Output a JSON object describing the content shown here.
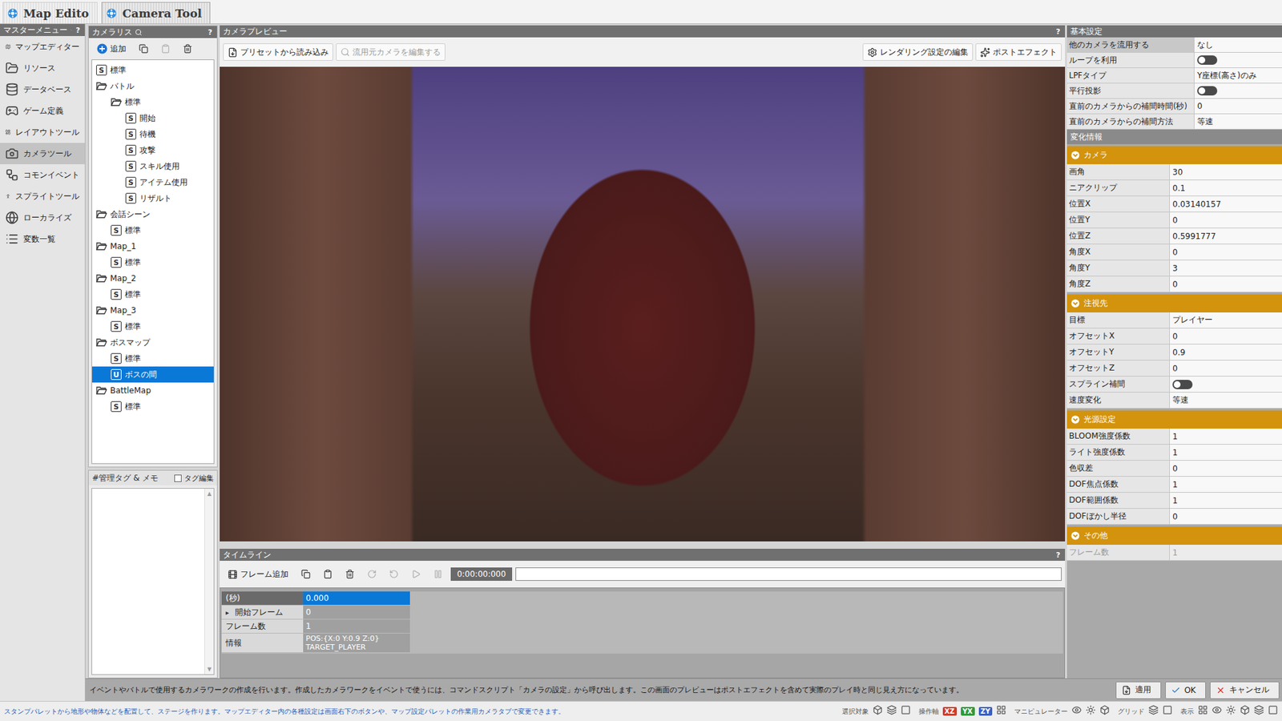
{
  "tabs": [
    {
      "label": "Map Edito",
      "selected": false
    },
    {
      "label": "Camera Tool",
      "selected": true
    }
  ],
  "master_menu": {
    "title": "マスターメニュー",
    "help": "?",
    "items": [
      {
        "label": "マップエディター",
        "selected": false
      },
      {
        "label": "リソース",
        "selected": false
      },
      {
        "label": "データベース",
        "selected": false
      },
      {
        "label": "ゲーム定義",
        "selected": false
      },
      {
        "label": "レイアウトツール",
        "selected": false
      },
      {
        "label": "カメラツール",
        "selected": true
      },
      {
        "label": "コモンイベント",
        "selected": false
      },
      {
        "label": "スプライトツール",
        "selected": false
      },
      {
        "label": "ローカライズ",
        "selected": false
      },
      {
        "label": "変数一覧",
        "selected": false
      }
    ]
  },
  "camera_list": {
    "title": "カメラリス",
    "help": "?",
    "add_label": "追加",
    "paste_disabled": true,
    "tree": [
      {
        "label": "標準",
        "level": 0,
        "kind": "script",
        "icon": "S",
        "selected": false
      },
      {
        "label": "バトル",
        "level": 0,
        "kind": "folder",
        "expanded": true,
        "selected": false
      },
      {
        "label": "標準",
        "level": 1,
        "kind": "folder",
        "expanded": true,
        "selected": false
      },
      {
        "label": "開始",
        "level": 2,
        "kind": "script",
        "icon": "S",
        "selected": false
      },
      {
        "label": "待機",
        "level": 2,
        "kind": "script",
        "icon": "S",
        "selected": false
      },
      {
        "label": "攻撃",
        "level": 2,
        "kind": "script",
        "icon": "S",
        "selected": false
      },
      {
        "label": "スキル使用",
        "level": 2,
        "kind": "script",
        "icon": "S",
        "selected": false
      },
      {
        "label": "アイテム使用",
        "level": 2,
        "kind": "script",
        "icon": "S",
        "selected": false
      },
      {
        "label": "リザルト",
        "level": 2,
        "kind": "script",
        "icon": "S",
        "selected": false
      },
      {
        "label": "会話シーン",
        "level": 0,
        "kind": "folder",
        "expanded": true,
        "selected": false
      },
      {
        "label": "標準",
        "level": 1,
        "kind": "script",
        "icon": "S",
        "selected": false
      },
      {
        "label": "Map_1",
        "level": 0,
        "kind": "folder",
        "expanded": true,
        "selected": false
      },
      {
        "label": "標準",
        "level": 1,
        "kind": "script",
        "icon": "S",
        "selected": false
      },
      {
        "label": "Map_2",
        "level": 0,
        "kind": "folder",
        "expanded": true,
        "selected": false
      },
      {
        "label": "標準",
        "level": 1,
        "kind": "script",
        "icon": "S",
        "selected": false
      },
      {
        "label": "Map_3",
        "level": 0,
        "kind": "folder",
        "expanded": true,
        "selected": false
      },
      {
        "label": "標準",
        "level": 1,
        "kind": "script",
        "icon": "S",
        "selected": false
      },
      {
        "label": "ボスマップ",
        "level": 0,
        "kind": "folder",
        "expanded": true,
        "selected": false
      },
      {
        "label": "標準",
        "level": 1,
        "kind": "script",
        "icon": "S",
        "selected": false
      },
      {
        "label": "ボスの間",
        "level": 1,
        "kind": "script",
        "icon": "U",
        "selected": true
      },
      {
        "label": "BattleMap",
        "level": 0,
        "kind": "folder",
        "expanded": true,
        "selected": false
      },
      {
        "label": "標準",
        "level": 1,
        "kind": "script",
        "icon": "S",
        "selected": false
      }
    ]
  },
  "memo": {
    "title": "#管理タグ & メモ",
    "tag_edit": "タグ編集",
    "tag_checked": false,
    "scroll_up": "▲",
    "scroll_down": "▼"
  },
  "preview": {
    "title": "カメラプレビュー",
    "help": "?",
    "preset": "プリセットから読み込み",
    "edit_source": {
      "label": "流用元カメラを編集する",
      "disabled": true
    },
    "render": "レンダリング設定の編集",
    "post": "ポストエフェクト"
  },
  "timeline": {
    "title": "タイムライン",
    "help": "?",
    "add_frame": "フレーム追加",
    "time": "0:00:00:000",
    "level": 0,
    "rows": [
      {
        "kind": "head",
        "marker": "",
        "label": "(秒)",
        "lines": [
          "0.000"
        ],
        "selected": true
      },
      {
        "kind": "row",
        "marker": "▸",
        "label": "開始フレーム",
        "lines": [
          "0"
        ],
        "selected": false
      },
      {
        "kind": "row",
        "marker": "",
        "label": "フレーム数",
        "lines": [
          "1"
        ],
        "selected": false
      },
      {
        "kind": "row",
        "marker": "",
        "label": "情報",
        "lines": [
          "POS:{X:0 Y:0.9 Z:0}",
          "TARGET_PLAYER"
        ],
        "selected": false
      }
    ]
  },
  "properties": {
    "basic": {
      "title": "基本設定",
      "rows": [
        {
          "label": "他のカメラを流用する",
          "kind": "text",
          "value": "なし",
          "selected": true,
          "disabled": false
        },
        {
          "label": "ループを利用",
          "kind": "toggle",
          "on": false,
          "selected": false,
          "disabled": false
        },
        {
          "label": "LPFタイプ",
          "kind": "text",
          "value": "Y座標(高さ)のみ",
          "selected": false,
          "disabled": false
        },
        {
          "label": "平行投影",
          "kind": "toggle",
          "on": false,
          "selected": false,
          "disabled": false
        },
        {
          "label": "直前のカメラからの補間時間(秒)",
          "kind": "text",
          "value": "0",
          "selected": false,
          "disabled": false
        },
        {
          "label": "直前のカメラからの補間方法",
          "kind": "text",
          "value": "等速",
          "selected": false,
          "disabled": false
        }
      ]
    },
    "change_title": "変化情報",
    "sections": [
      {
        "title": "カメラ",
        "expanded": true,
        "rows": [
          {
            "label": "画角",
            "kind": "text",
            "value": "30",
            "selected": false,
            "disabled": false
          },
          {
            "label": "ニアクリップ",
            "kind": "text",
            "value": "0.1",
            "selected": false,
            "disabled": false
          },
          {
            "label": "位置X",
            "kind": "text",
            "value": "0.03140157",
            "selected": false,
            "disabled": false
          },
          {
            "label": "位置Y",
            "kind": "text",
            "value": "0",
            "selected": false,
            "disabled": false
          },
          {
            "label": "位置Z",
            "kind": "text",
            "value": "0.5991777",
            "selected": false,
            "disabled": false
          },
          {
            "label": "角度X",
            "kind": "text",
            "value": "0",
            "selected": false,
            "disabled": false
          },
          {
            "label": "角度Y",
            "kind": "text",
            "value": "3",
            "selected": false,
            "disabled": false
          },
          {
            "label": "角度Z",
            "kind": "text",
            "value": "0",
            "selected": false,
            "disabled": false
          }
        ]
      },
      {
        "title": "注視先",
        "expanded": true,
        "rows": [
          {
            "label": "目標",
            "kind": "text",
            "value": "プレイヤー",
            "selected": false,
            "disabled": false
          },
          {
            "label": "オフセットX",
            "kind": "text",
            "value": "0",
            "selected": false,
            "disabled": false
          },
          {
            "label": "オフセットY",
            "kind": "text",
            "value": "0.9",
            "selected": false,
            "disabled": false
          },
          {
            "label": "オフセットZ",
            "kind": "text",
            "value": "0",
            "selected": false,
            "disabled": false
          },
          {
            "label": "スプライン補間",
            "kind": "toggle",
            "on": false,
            "selected": false,
            "disabled": false
          },
          {
            "label": "速度変化",
            "kind": "text",
            "value": "等速",
            "selected": false,
            "disabled": false
          }
        ]
      },
      {
        "title": "光源設定",
        "expanded": true,
        "rows": [
          {
            "label": "BLOOM強度係数",
            "kind": "text",
            "value": "1",
            "selected": false,
            "disabled": false
          },
          {
            "label": "ライト強度係数",
            "kind": "text",
            "value": "1",
            "selected": false,
            "disabled": false
          },
          {
            "label": "色収差",
            "kind": "text",
            "value": "0",
            "selected": false,
            "disabled": false
          },
          {
            "label": "DOF焦点係数",
            "kind": "text",
            "value": "1",
            "selected": false,
            "disabled": false
          },
          {
            "label": "DOF範囲係数",
            "kind": "text",
            "value": "1",
            "selected": false,
            "disabled": false
          },
          {
            "label": "DOFぼかし半径",
            "kind": "text",
            "value": "0",
            "selected": false,
            "disabled": false
          }
        ]
      },
      {
        "title": "その他",
        "expanded": true,
        "rows": [
          {
            "label": "フレーム数",
            "kind": "text",
            "value": "1",
            "selected": false,
            "disabled": true
          }
        ]
      }
    ]
  },
  "help_bar": {
    "text": "イベントやバトルで使用するカメラワークの作成を行います。作成したカメラワークをイベントで使うには、コマンドスクリプト「カメラの設定」から呼び出します。この画面のプレビューはポストエフェクトを含めて実際のプレイ時と同じ見え方になっています。",
    "buttons": [
      {
        "label": "適用",
        "kind": "apply"
      },
      {
        "label": "OK",
        "kind": "ok"
      },
      {
        "label": "キャンセル",
        "kind": "cancel"
      }
    ]
  },
  "status_bar": {
    "text": "スタンプパレットから地形や物体などを配置して、ステージを作ります。マップエディター内の各種設定は画面右下のボタンや、マップ設定パレットの作業用カメラタブで変更できます。",
    "tools": [
      {
        "kind": "label",
        "text": "選択対象"
      },
      {
        "kind": "icon"
      },
      {
        "kind": "icon"
      },
      {
        "kind": "icon"
      },
      {
        "kind": "label",
        "text": "操作軸"
      },
      {
        "kind": "badge",
        "text": "XZ",
        "color": "#d43a2a"
      },
      {
        "kind": "badge",
        "text": "YX",
        "color": "#2f9a3a"
      },
      {
        "kind": "badge",
        "text": "ZY",
        "color": "#3a5fc4"
      },
      {
        "kind": "icon"
      },
      {
        "kind": "label",
        "text": "マニピュレーター"
      },
      {
        "kind": "icon"
      },
      {
        "kind": "icon"
      },
      {
        "kind": "icon"
      },
      {
        "kind": "label",
        "text": "グリッド"
      },
      {
        "kind": "icon"
      },
      {
        "kind": "icon"
      },
      {
        "kind": "label",
        "text": "表示"
      },
      {
        "kind": "icon"
      },
      {
        "kind": "icon"
      },
      {
        "kind": "icon"
      },
      {
        "kind": "icon"
      },
      {
        "kind": "icon"
      },
      {
        "kind": "icon"
      }
    ]
  }
}
